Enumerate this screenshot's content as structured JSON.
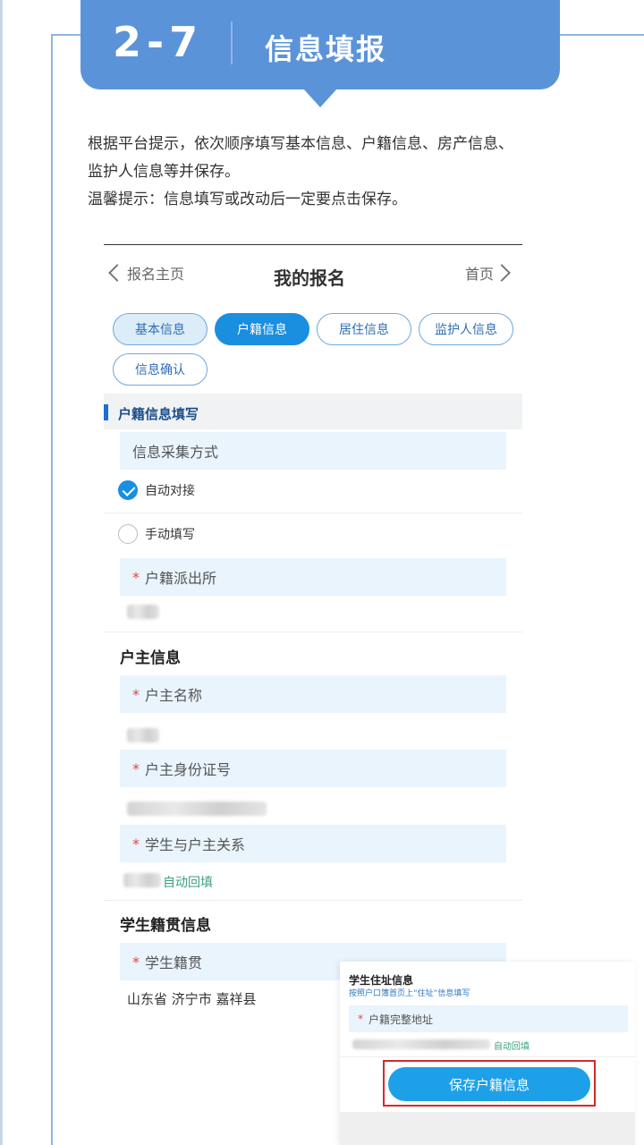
{
  "banner": {
    "step": "2-7",
    "title": "信息填报"
  },
  "intro": {
    "line1": "根据平台提示，依次顺序填写基本信息、户籍信息、房产信息、",
    "line2": "监护人信息等并保存。",
    "line3": "温馨提示：信息填写或改动后一定要点击保存。"
  },
  "nav": {
    "back": "报名主页",
    "title": "我的报名",
    "home": "首页"
  },
  "tabs": [
    "基本信息",
    "户籍信息",
    "居住信息",
    "监护人信息",
    "信息确认"
  ],
  "form": {
    "section_title": "户籍信息填写",
    "collection_label": "信息采集方式",
    "option_auto": "自动对接",
    "option_manual": "手动填写",
    "police_label": "户籍派出所",
    "head_group": "户主信息",
    "head_name_label": "户主名称",
    "head_id_label": "户主身份证号",
    "relation_label": "学生与户主关系",
    "autofill": "自动回填",
    "origin_group": "学生籍贯信息",
    "origin_label": "学生籍贯",
    "origin_value": "山东省 济宁市 嘉祥县",
    "required_mark": "*"
  },
  "overlay": {
    "title": "学生住址信息",
    "subtitle": "按照户口簿首页上“住址”信息填写",
    "address_label": "户籍完整地址",
    "autofill": "自动回填",
    "save_button": "保存户籍信息"
  }
}
